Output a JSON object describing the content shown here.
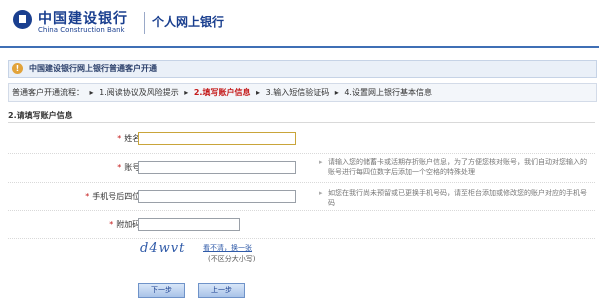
{
  "header": {
    "brand_cn": "中国建设银行",
    "brand_en": "China Construction Bank",
    "subtitle": "个人网上银行"
  },
  "title": "中国建设银行网上银行普通客户开通",
  "steps": {
    "prefix": "普通客户开通流程：",
    "items": [
      "1.阅读协议及风险提示",
      "2.填写账户信息",
      "3.输入短信验证码",
      "4.设置网上银行基本信息"
    ],
    "active_index": 1
  },
  "section_title": "2.请填写账户信息",
  "form": {
    "name_label": "姓名:",
    "account_label": "账号:",
    "account_hint": "请输入您的储蓄卡或活期存折账户信息，为了方便您核对账号，我们自动对您输入的账号进行每四位数字后添加一个空格的特殊处理",
    "phone_label": "手机号后四位:",
    "phone_hint": "如您在我行尚未预留或已更换手机号码，请至柜台添加或修改您的账户对应的手机号码",
    "captcha_label": "附加码:",
    "captcha_image_text": "d4wvt",
    "captcha_refresh": "看不清，换一张",
    "captcha_note": "(不区分大小写)"
  },
  "buttons": {
    "next": "下一步",
    "prev": "上一步"
  },
  "colors": {
    "brand_blue": "#1a3f8f",
    "active_step": "#c41a1a"
  }
}
